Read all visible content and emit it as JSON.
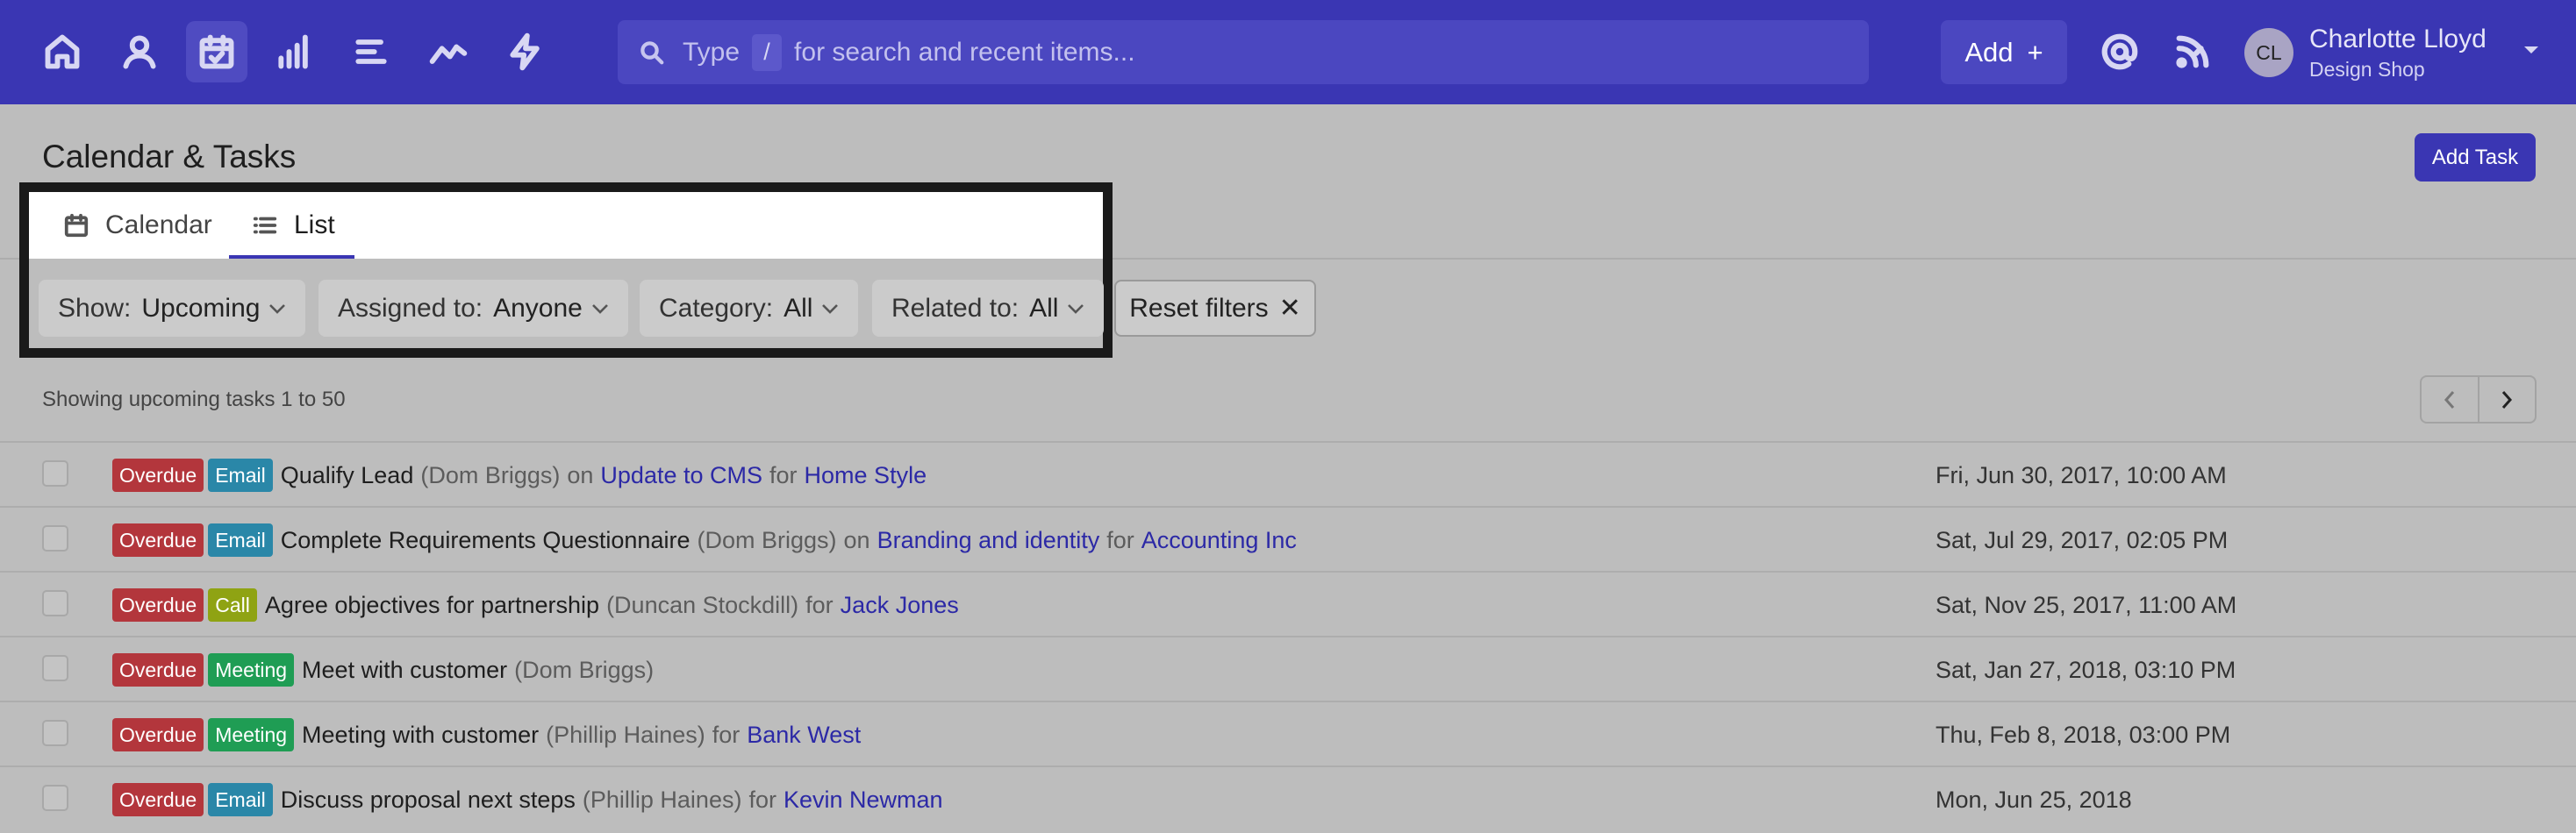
{
  "nav": {
    "items": [
      {
        "icon": "home-icon"
      },
      {
        "icon": "user-icon"
      },
      {
        "icon": "calendar-check-icon"
      },
      {
        "icon": "bar-chart-icon"
      },
      {
        "icon": "list-icon"
      },
      {
        "icon": "trend-line-icon"
      },
      {
        "icon": "lightning-icon"
      }
    ],
    "search": {
      "type_label": "Type",
      "slash": "/",
      "rest": "for search and recent items..."
    },
    "add_label": "Add",
    "add_plus": "+",
    "user": {
      "initials": "CL",
      "name": "Charlotte Lloyd",
      "org": "Design Shop"
    }
  },
  "page": {
    "title": "Calendar & Tasks",
    "add_task_label": "Add Task",
    "tabs": [
      {
        "label": "Calendar",
        "icon": "calendar-icon"
      },
      {
        "label": "List",
        "icon": "list-icon",
        "active": true
      }
    ],
    "filters": [
      {
        "label": "Show:",
        "value": "Upcoming"
      },
      {
        "label": "Assigned to:",
        "value": "Anyone"
      },
      {
        "label": "Category:",
        "value": "All"
      },
      {
        "label": "Related to:",
        "value": "All"
      }
    ],
    "reset_label": "Reset filters",
    "reset_x": "✕",
    "showing": "Showing upcoming tasks 1 to 50"
  },
  "tasks": [
    {
      "status": "Overdue",
      "type": "Email",
      "title": "Qualify Lead",
      "person": "(Dom Briggs)",
      "on_word": "on",
      "on": "Update to CMS",
      "for_word": "for",
      "for": "Home Style",
      "date": "Fri, Jun 30, 2017, 10:00 AM"
    },
    {
      "status": "Overdue",
      "type": "Email",
      "title": "Complete Requirements Questionnaire",
      "person": "(Dom Briggs)",
      "on_word": "on",
      "on": "Branding and identity",
      "for_word": "for",
      "for": "Accounting Inc",
      "date": "Sat, Jul 29, 2017, 02:05 PM"
    },
    {
      "status": "Overdue",
      "type": "Call",
      "title": "Agree objectives for partnership",
      "person": "(Duncan Stockdill)",
      "for_word": "for",
      "for": "Jack Jones",
      "date": "Sat, Nov 25, 2017, 11:00 AM"
    },
    {
      "status": "Overdue",
      "type": "Meeting",
      "title": "Meet with customer",
      "person": "(Dom Briggs)",
      "date": "Sat, Jan 27, 2018, 03:10 PM"
    },
    {
      "status": "Overdue",
      "type": "Meeting",
      "title": "Meeting with customer",
      "person": "(Phillip Haines)",
      "for_word": "for",
      "for": "Bank West",
      "date": "Thu, Feb 8, 2018, 03:00 PM"
    },
    {
      "status": "Overdue",
      "type": "Email",
      "title": "Discuss proposal next steps",
      "person": "(Phillip Haines)",
      "for_word": "for",
      "for": "Kevin Newman",
      "date": "Mon, Jun 25, 2018"
    }
  ]
}
